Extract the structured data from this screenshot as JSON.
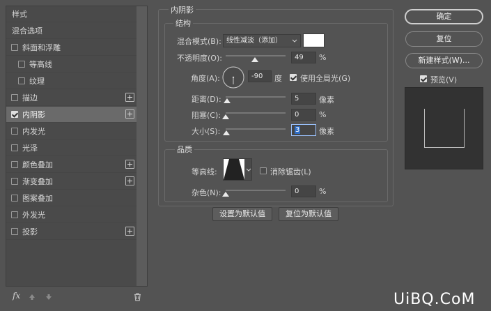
{
  "styles_panel": {
    "styles_label": "样式",
    "blending_options_label": "混合选项",
    "items": [
      {
        "label": "斜面和浮雕",
        "checked": false
      },
      {
        "label": "等高线",
        "checked": false
      },
      {
        "label": "纹理",
        "checked": false
      },
      {
        "label": "描边",
        "checked": false
      },
      {
        "label": "内阴影",
        "checked": true
      },
      {
        "label": "内发光",
        "checked": false
      },
      {
        "label": "光泽",
        "checked": false
      },
      {
        "label": "颜色叠加",
        "checked": false
      },
      {
        "label": "渐变叠加",
        "checked": false
      },
      {
        "label": "图案叠加",
        "checked": false
      },
      {
        "label": "外发光",
        "checked": false
      },
      {
        "label": "投影",
        "checked": false
      }
    ],
    "fx_label": "fx"
  },
  "inner_shadow": {
    "title": "内阴影",
    "structure": {
      "title": "结构",
      "blend_mode_label": "混合模式(B):",
      "blend_mode_value": "线性减淡（添加）",
      "opacity_label": "不透明度(O):",
      "opacity_value": "49",
      "opacity_unit": "%",
      "opacity_fraction": 0.49,
      "angle_label": "角度(A):",
      "angle_value": "-90",
      "angle_unit": "度",
      "global_light_label": "使用全局光(G)",
      "global_light_checked": true,
      "distance_label": "距离(D):",
      "distance_value": "5",
      "distance_unit": "像素",
      "distance_fraction": 0.02,
      "choke_label": "阻塞(C):",
      "choke_value": "0",
      "choke_unit": "%",
      "choke_fraction": 0.0,
      "size_label": "大小(S):",
      "size_value": "3",
      "size_unit": "像素",
      "size_fraction": 0.01
    },
    "quality": {
      "title": "品质",
      "contour_label": "等高线:",
      "anti_aliased_label": "消除锯齿(L)",
      "anti_aliased_checked": false,
      "noise_label": "杂色(N):",
      "noise_value": "0",
      "noise_unit": "%",
      "noise_fraction": 0.0
    },
    "make_default_label": "设置为默认值",
    "reset_default_label": "复位为默认值"
  },
  "right_panel": {
    "ok_label": "确定",
    "reset_label": "复位",
    "new_style_label": "新建样式(W)...",
    "preview_label": "预览(V)",
    "preview_checked": true
  },
  "watermark": "UiBQ.CoM"
}
